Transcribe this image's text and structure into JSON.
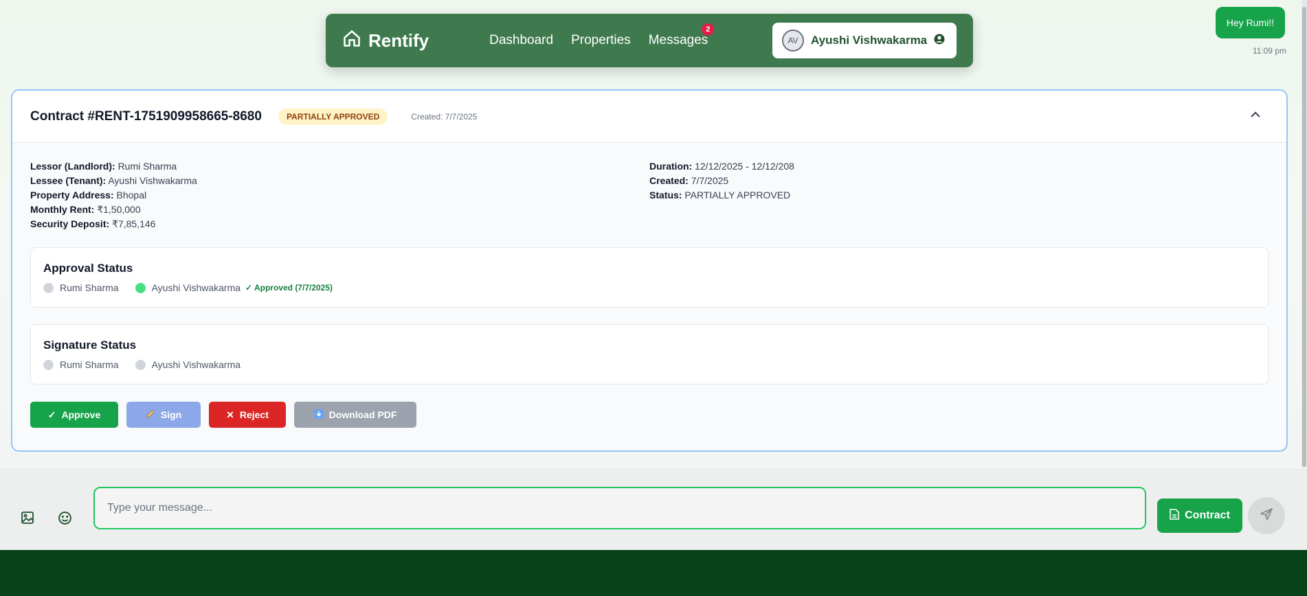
{
  "nav": {
    "brand": "Rentify",
    "links": [
      "Dashboard",
      "Properties",
      "Messages"
    ],
    "messages_badge": "2",
    "user_initials": "AV",
    "user_name": "Ayushi Vishwakarma"
  },
  "chat": {
    "bubble_text": "Hey Rumi!!",
    "bubble_time": "11:09 pm"
  },
  "contract": {
    "title": "Contract #RENT-1751909958665-8680",
    "status_pill": "PARTIALLY APPROVED",
    "created_small": "Created: 7/7/2025",
    "left": [
      {
        "label": "Lessor (Landlord):",
        "value": "Rumi Sharma"
      },
      {
        "label": "Lessee (Tenant):",
        "value": "Ayushi Vishwakarma"
      },
      {
        "label": "Property Address:",
        "value": "Bhopal"
      },
      {
        "label": "Monthly Rent:",
        "value": "₹1,50,000"
      },
      {
        "label": "Security Deposit:",
        "value": "₹7,85,146"
      }
    ],
    "right": [
      {
        "label": "Duration:",
        "value": "12/12/2025 - 12/12/208"
      },
      {
        "label": "Created:",
        "value": "7/7/2025"
      },
      {
        "label": "Status:",
        "value": "PARTIALLY APPROVED"
      }
    ],
    "approval": {
      "title": "Approval Status",
      "parties": [
        "Rumi Sharma",
        "Ayushi Vishwakarma"
      ],
      "approved_note": "✓ Approved (7/7/2025)"
    },
    "signature": {
      "title": "Signature Status",
      "parties": [
        "Rumi Sharma",
        "Ayushi Vishwakarma"
      ]
    },
    "buttons": {
      "approve": "Approve",
      "sign": "Sign",
      "reject": "Reject",
      "download": "Download PDF"
    }
  },
  "composer": {
    "placeholder": "Type your message...",
    "contract_button": "Contract"
  },
  "colors": {
    "nav_bg": "#3f7a4f",
    "primary_green": "#16a34a",
    "reject_red": "#dc2626",
    "footer_bg": "#064318"
  }
}
